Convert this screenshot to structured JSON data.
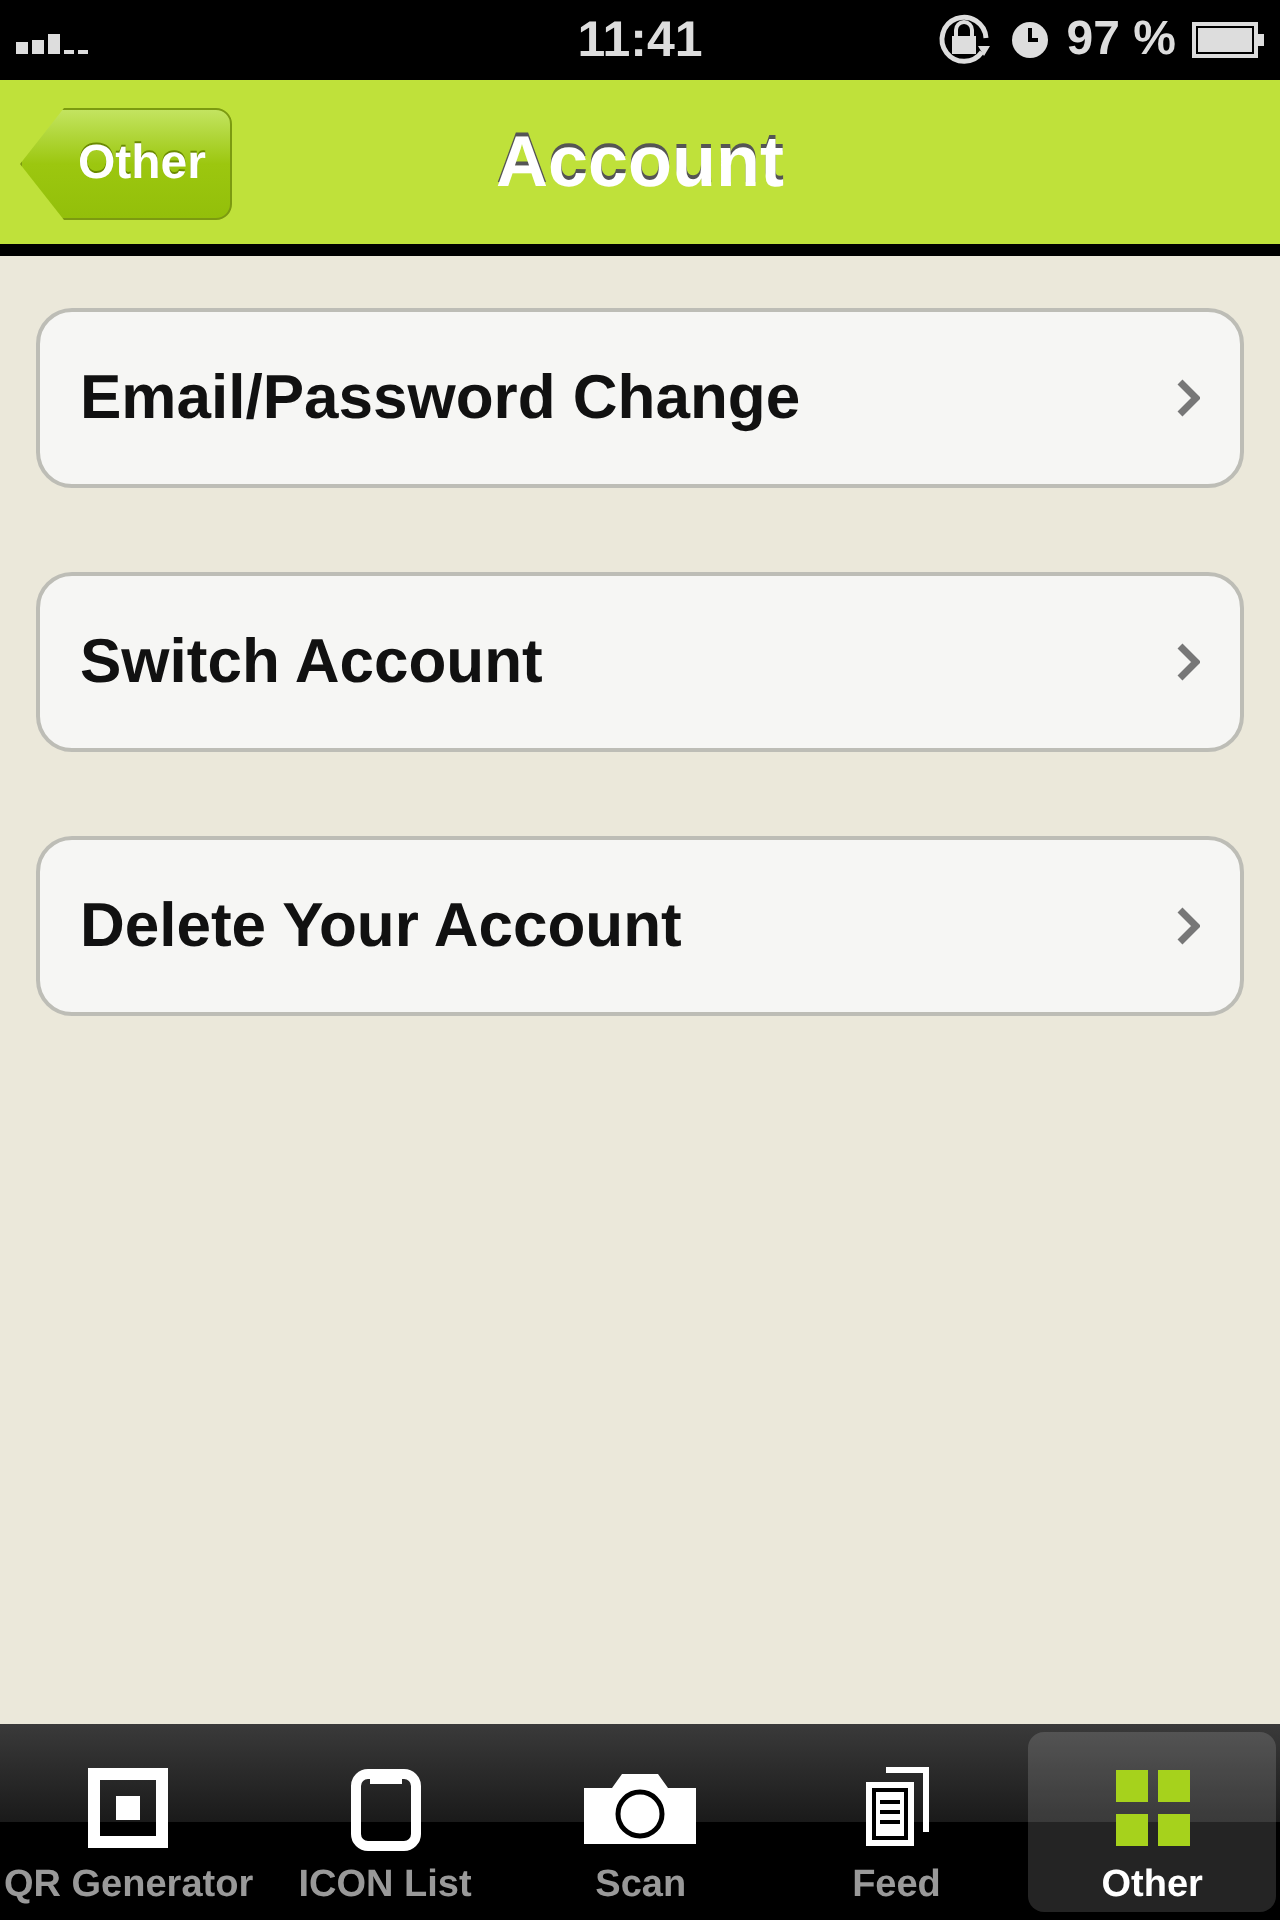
{
  "status_bar": {
    "time": "11:41",
    "battery": "97 %"
  },
  "nav_bar": {
    "back_button": "Other",
    "title": "Account"
  },
  "menu_items": [
    {
      "label": "Email/Password Change"
    },
    {
      "label": "Switch Account"
    },
    {
      "label": "Delete Your Account"
    }
  ],
  "tab_bar": [
    {
      "label": "QR Generator",
      "kind": "qr",
      "selected": false
    },
    {
      "label": "ICON List",
      "kind": "list",
      "selected": false
    },
    {
      "label": "Scan",
      "kind": "camera",
      "selected": false
    },
    {
      "label": "Feed",
      "kind": "feed",
      "selected": false
    },
    {
      "label": "Other",
      "kind": "grid",
      "selected": true
    }
  ]
}
